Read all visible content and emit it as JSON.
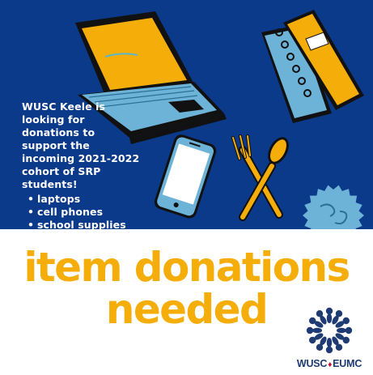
{
  "colors": {
    "background_top": "#0b3a8a",
    "background_bottom": "#ffffff",
    "accent": "#f5ad0a",
    "device_light_blue": "#6db3d8",
    "logo_blue": "#1e3b73",
    "leaf_red": "#c8102e"
  },
  "blurb": {
    "intro": "WUSC Keele is looking for donations to support the incoming 2021-2022 cohort of SRP students!",
    "items": [
      "laptops",
      "cell phones",
      "school supplies"
    ]
  },
  "illustrations": [
    "laptop-icon",
    "notebooks-icon",
    "phone-icon",
    "fork-spoon-icon",
    "helping-hands-badge-icon"
  ],
  "headline": {
    "line1": "item donations",
    "line2": "needed"
  },
  "logo": {
    "left": "WUSC",
    "right": "EUMC"
  }
}
